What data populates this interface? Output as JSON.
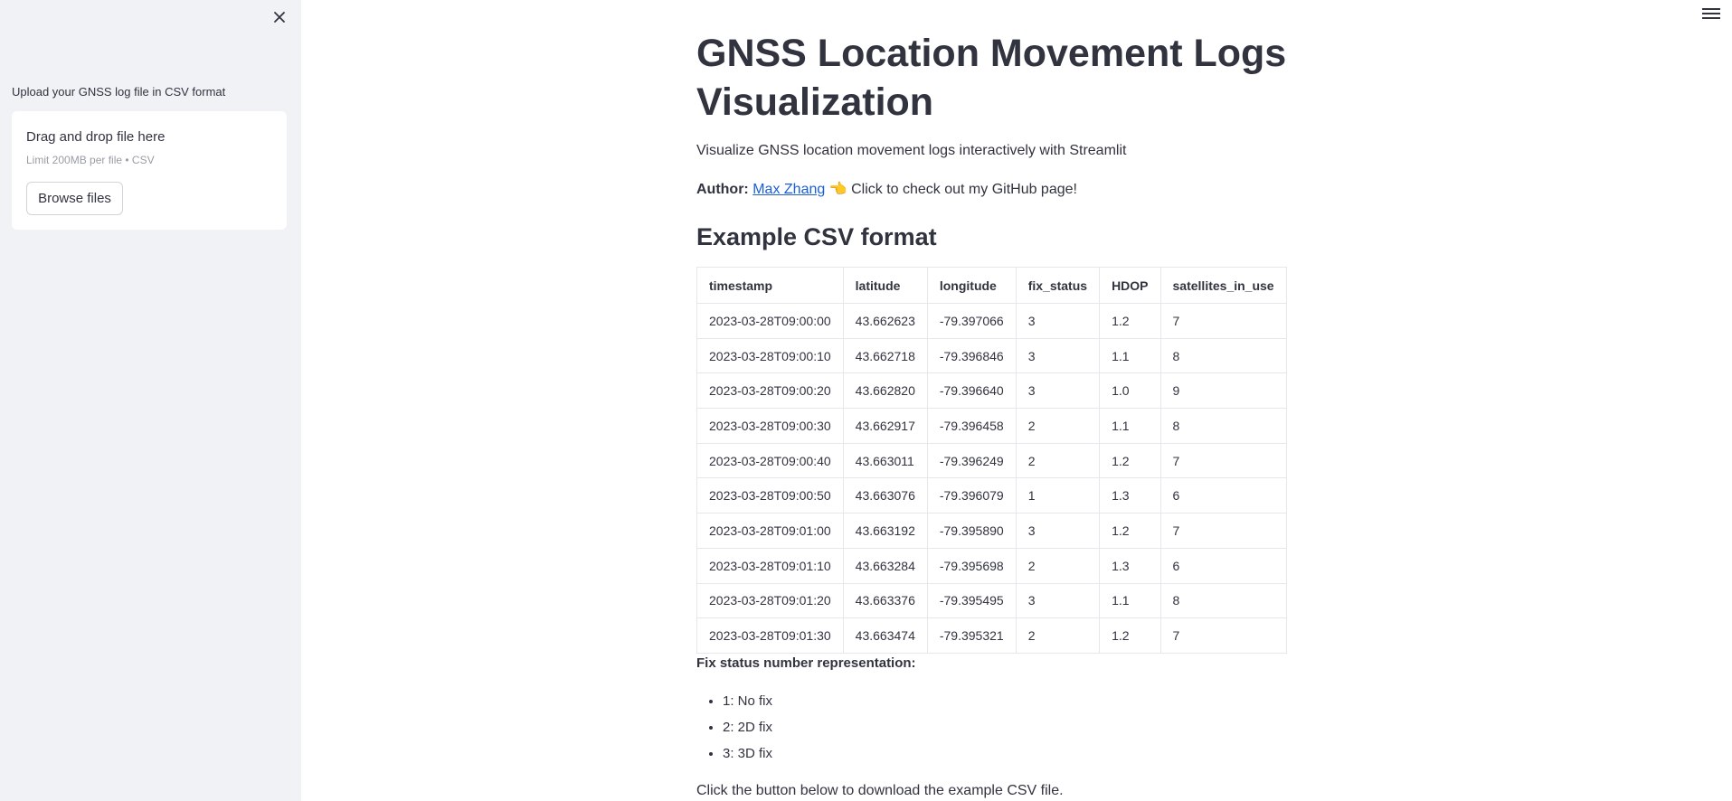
{
  "sidebar": {
    "upload_label": "Upload your GNSS log file in CSV format",
    "dropzone_title": "Drag and drop file here",
    "dropzone_limit": "Limit 200MB per file • CSV",
    "browse_label": "Browse files"
  },
  "main": {
    "title": "GNSS Location Movement Logs Visualization",
    "subtitle": "Visualize GNSS location movement logs interactively with Streamlit",
    "author_label": "Author:",
    "author_name": "Max Zhang",
    "author_emoji": "👈",
    "author_suffix": " Click to check out my GitHub page!",
    "section_title": "Example CSV format",
    "fix_title": "Fix status number representation:",
    "fix_items": [
      "1: No fix",
      "2: 2D fix",
      "3: 3D fix"
    ],
    "download_note": "Click the button below to download the example CSV file."
  },
  "table": {
    "headers": [
      "timestamp",
      "latitude",
      "longitude",
      "fix_status",
      "HDOP",
      "satellites_in_use"
    ],
    "rows": [
      [
        "2023-03-28T09:00:00",
        "43.662623",
        "-79.397066",
        "3",
        "1.2",
        "7"
      ],
      [
        "2023-03-28T09:00:10",
        "43.662718",
        "-79.396846",
        "3",
        "1.1",
        "8"
      ],
      [
        "2023-03-28T09:00:20",
        "43.662820",
        "-79.396640",
        "3",
        "1.0",
        "9"
      ],
      [
        "2023-03-28T09:00:30",
        "43.662917",
        "-79.396458",
        "2",
        "1.1",
        "8"
      ],
      [
        "2023-03-28T09:00:40",
        "43.663011",
        "-79.396249",
        "2",
        "1.2",
        "7"
      ],
      [
        "2023-03-28T09:00:50",
        "43.663076",
        "-79.396079",
        "1",
        "1.3",
        "6"
      ],
      [
        "2023-03-28T09:01:00",
        "43.663192",
        "-79.395890",
        "3",
        "1.2",
        "7"
      ],
      [
        "2023-03-28T09:01:10",
        "43.663284",
        "-79.395698",
        "2",
        "1.3",
        "6"
      ],
      [
        "2023-03-28T09:01:20",
        "43.663376",
        "-79.395495",
        "3",
        "1.1",
        "8"
      ],
      [
        "2023-03-28T09:01:30",
        "43.663474",
        "-79.395321",
        "2",
        "1.2",
        "7"
      ]
    ]
  }
}
